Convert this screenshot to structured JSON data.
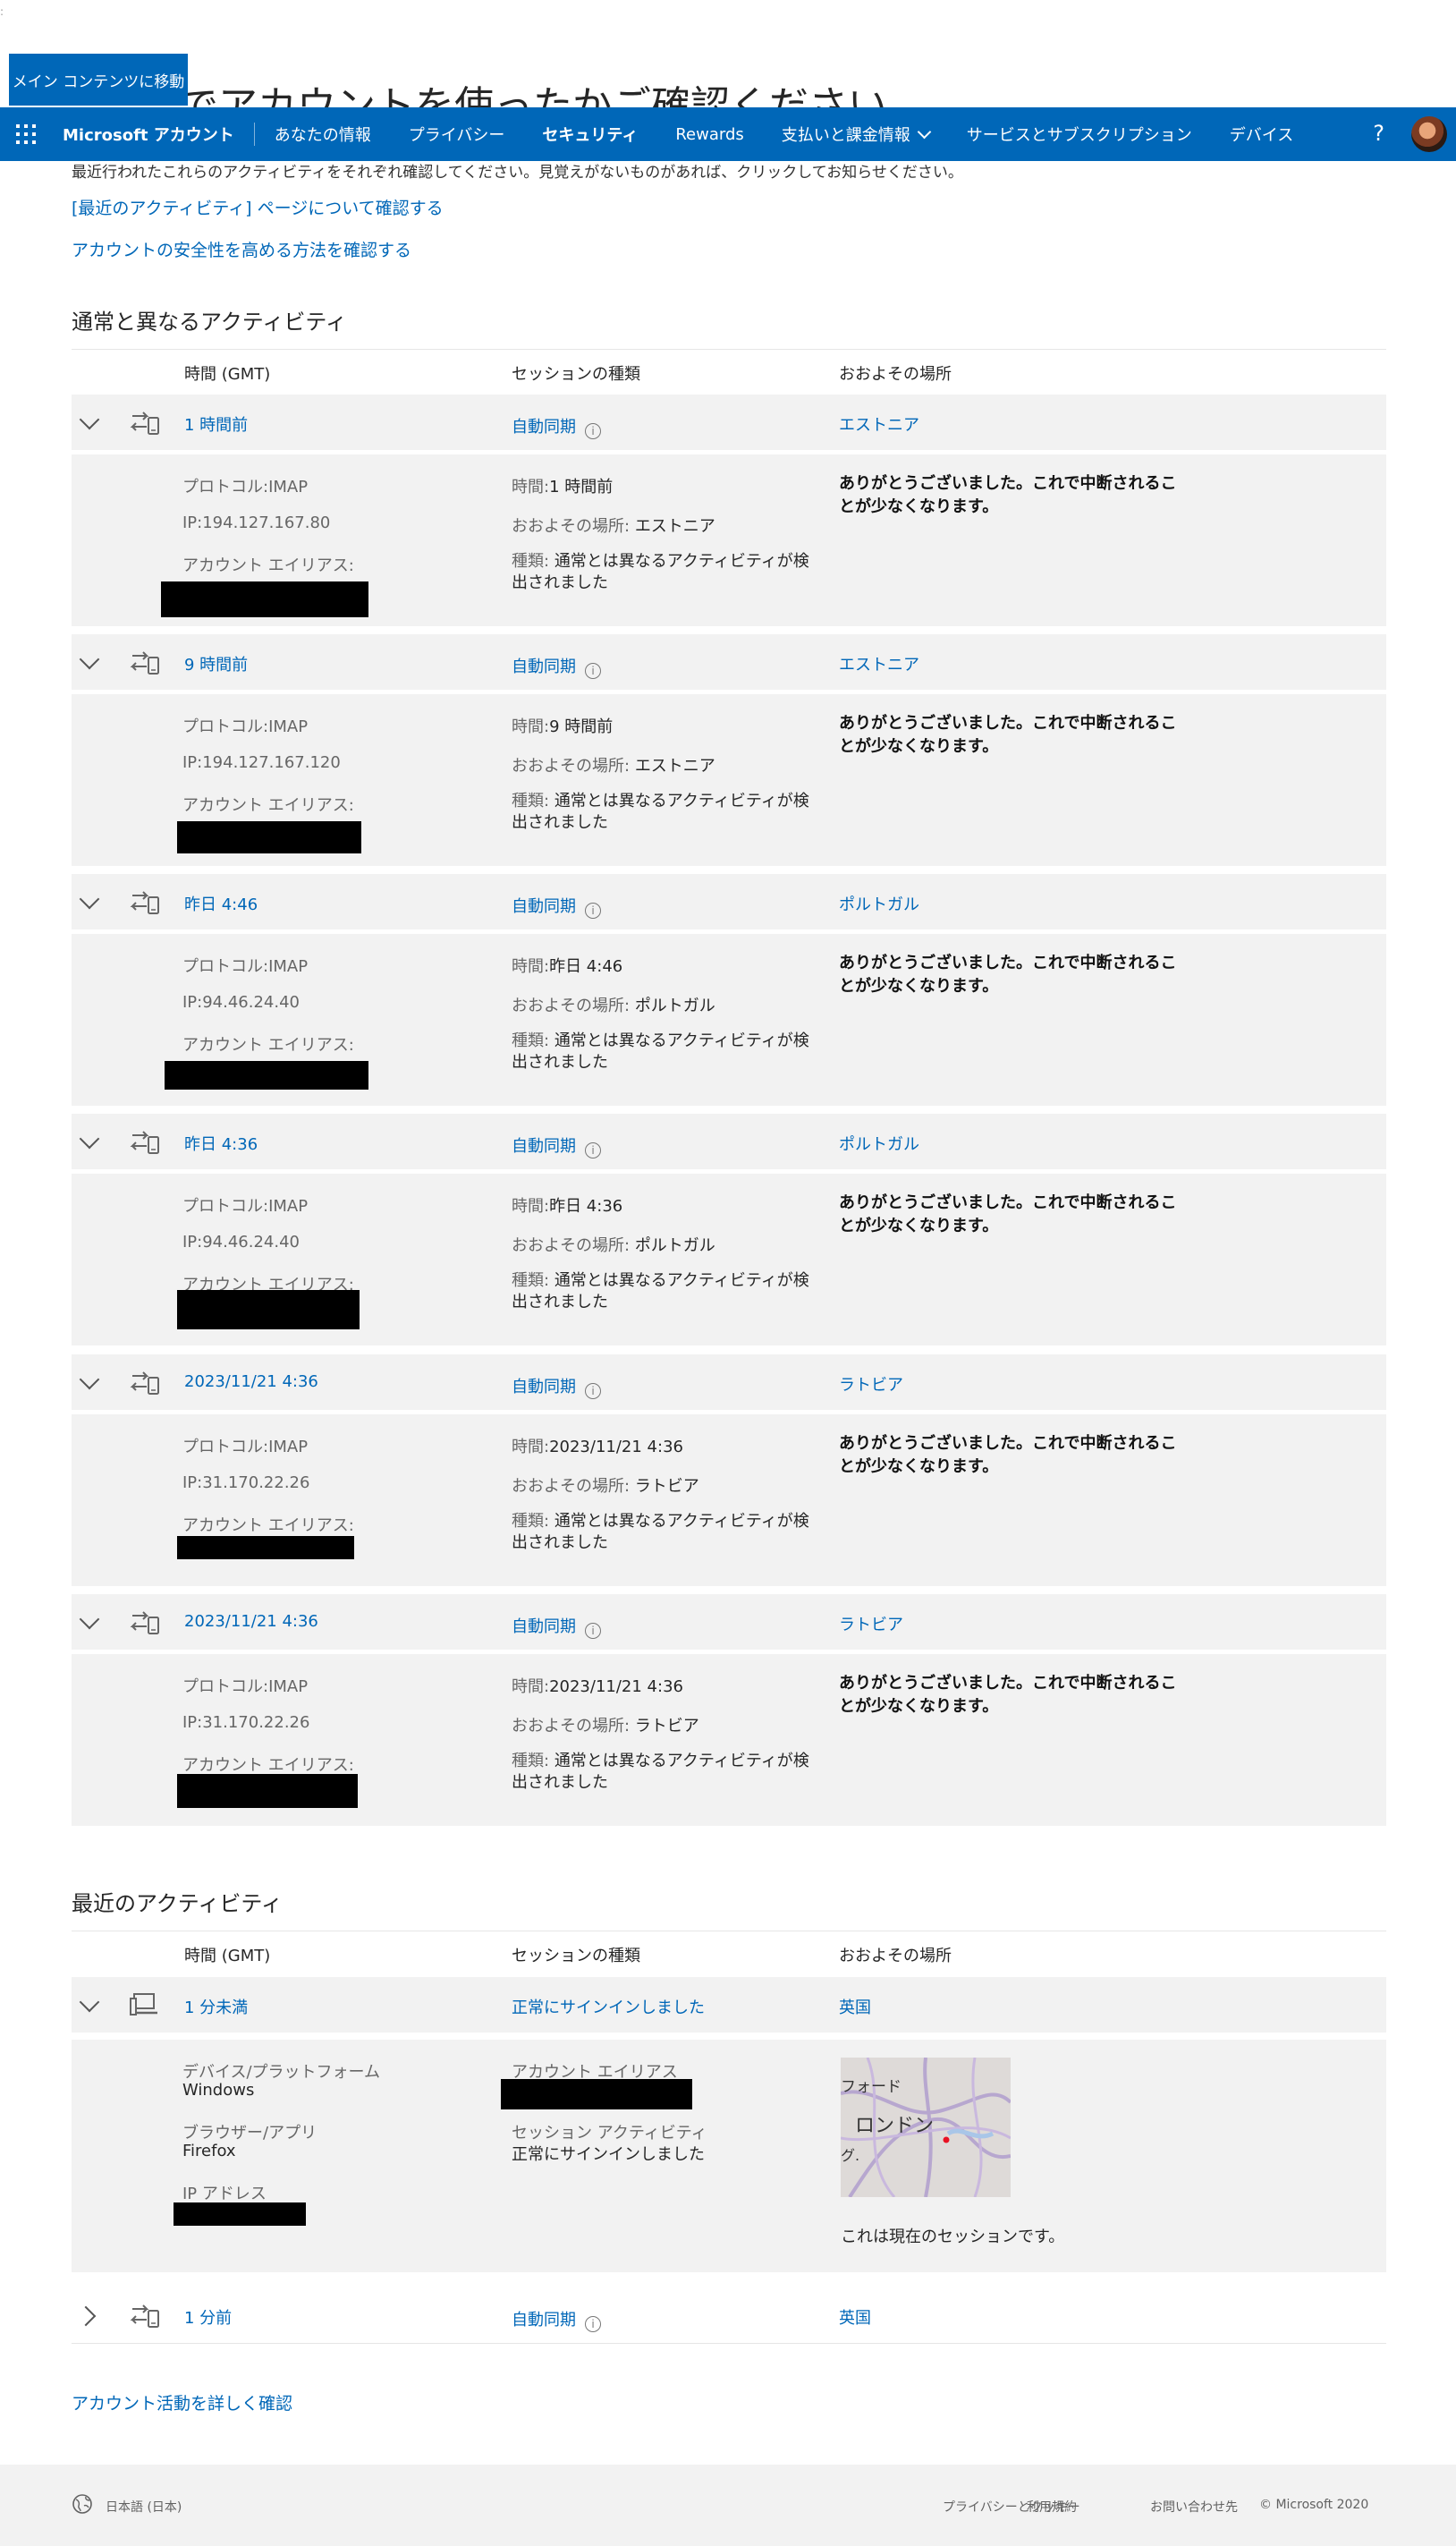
{
  "skip_link": "メイン コンテンツに移動",
  "hidden_title": "でアカウントを使ったかご確認ください",
  "under_nav_text": "最近行われたこれらのアクティビティをそれぞれ確認してください。見覚えがないものがあれば、クリックしてお知らせください。",
  "nav": {
    "brand": "Microsoft アカウント",
    "items": [
      "あなたの情報",
      "プライバシー",
      "セキュリティ",
      "Rewards",
      "支払いと課金情報",
      "サービスとサブスクリプション",
      "デバイス"
    ],
    "help": "?",
    "accent": "#0067b8"
  },
  "top_links": [
    "[最近のアクティビティ] ページについて確認する",
    "アカウントの安全性を高める方法を確認する"
  ],
  "unusual": {
    "title": "通常と異なるアクティビティ",
    "headers": [
      "時間 (GMT)",
      "セッションの種類",
      "おおよその場所"
    ],
    "rows": [
      {
        "time": "1 時間前",
        "session": "自動同期",
        "location": "エストニア",
        "protocol": "プロトコル:IMAP",
        "ip": "IP:194.127.167.80",
        "alias_label": "アカウント エイリアス:",
        "time_label": "時間:",
        "time_val": "1 時間前",
        "loc_label": "おおよその場所:",
        "loc_val": "エストニア",
        "type_label": "種類:",
        "type_val": "通常とは異なるアクティビティが検出されました",
        "thanks": "ありがとうございました。これで中断されることが少なくなります。"
      },
      {
        "time": "9 時間前",
        "session": "自動同期",
        "location": "エストニア",
        "protocol": "プロトコル:IMAP",
        "ip": "IP:194.127.167.120",
        "alias_label": "アカウント エイリアス:",
        "time_label": "時間:",
        "time_val": "9 時間前",
        "loc_label": "おおよその場所:",
        "loc_val": "エストニア",
        "type_label": "種類:",
        "type_val": "通常とは異なるアクティビティが検出されました",
        "thanks": "ありがとうございました。これで中断されることが少なくなります。"
      },
      {
        "time": "昨日 4:46",
        "session": "自動同期",
        "location": "ポルトガル",
        "protocol": "プロトコル:IMAP",
        "ip": "IP:94.46.24.40",
        "alias_label": "アカウント エイリアス:",
        "time_label": "時間:",
        "time_val": "昨日 4:46",
        "loc_label": "おおよその場所:",
        "loc_val": "ポルトガル",
        "type_label": "種類:",
        "type_val": "通常とは異なるアクティビティが検出されました",
        "thanks": "ありがとうございました。これで中断されることが少なくなります。"
      },
      {
        "time": "昨日 4:36",
        "session": "自動同期",
        "location": "ポルトガル",
        "protocol": "プロトコル:IMAP",
        "ip": "IP:94.46.24.40",
        "alias_label": "アカウント エイリアス:",
        "time_label": "時間:",
        "time_val": "昨日 4:36",
        "loc_label": "おおよその場所:",
        "loc_val": "ポルトガル",
        "type_label": "種類:",
        "type_val": "通常とは異なるアクティビティが検出されました",
        "thanks": "ありがとうございました。これで中断されることが少なくなります。"
      },
      {
        "time": "2023/11/21 4:36",
        "session": "自動同期",
        "location": "ラトビア",
        "protocol": "プロトコル:IMAP",
        "ip": "IP:31.170.22.26",
        "alias_label": "アカウント エイリアス:",
        "time_label": "時間:",
        "time_val": "2023/11/21 4:36",
        "loc_label": "おおよその場所:",
        "loc_val": "ラトビア",
        "type_label": "種類:",
        "type_val": "通常とは異なるアクティビティが検出されました",
        "thanks": "ありがとうございました。これで中断されることが少なくなります。"
      },
      {
        "time": "2023/11/21 4:36",
        "session": "自動同期",
        "location": "ラトビア",
        "protocol": "プロトコル:IMAP",
        "ip": "IP:31.170.22.26",
        "alias_label": "アカウント エイリアス:",
        "time_label": "時間:",
        "time_val": "2023/11/21 4:36",
        "loc_label": "おおよその場所:",
        "loc_val": "ラトビア",
        "type_label": "種類:",
        "type_val": "通常とは異なるアクティビティが検出されました",
        "thanks": "ありがとうございました。これで中断されることが少なくなります。"
      }
    ]
  },
  "recent": {
    "title": "最近のアクティビティ",
    "headers": [
      "時間 (GMT)",
      "セッションの種類",
      "おおよその場所"
    ],
    "expanded": {
      "time": "1 分未満",
      "session": "正常にサインインしました",
      "location": "英国",
      "device_label": "デバイス/プラットフォーム",
      "device_val": "Windows",
      "browser_label": "ブラウザー/アプリ",
      "browser_val": "Firefox",
      "ip_label": "IP アドレス",
      "alias_label": "アカウント エイリアス",
      "activity_label": "セッション アクティビティ",
      "activity_val": "正常にサインインしました",
      "map_labels": [
        "フォード",
        "ロンドン",
        "グ."
      ],
      "current_session": "これは現在のセッションです。"
    },
    "collapsed": {
      "time": "1 分前",
      "session": "自動同期",
      "location": "英国"
    },
    "more_link": "アカウント活動を詳しく確認"
  },
  "footer": {
    "language": "日本語 (日本)",
    "links": [
      "プライバシーとクッキー",
      "利用規約",
      "お問い合わせ先"
    ],
    "copyright": "© Microsoft 2020"
  }
}
